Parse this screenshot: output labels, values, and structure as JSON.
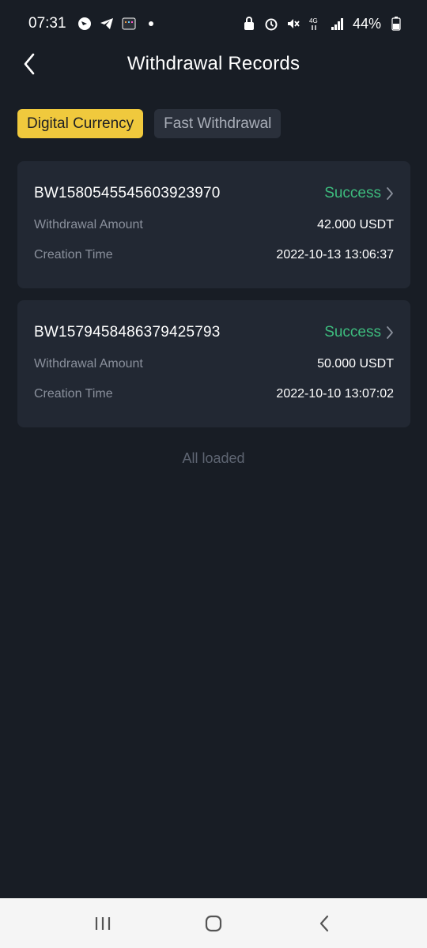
{
  "status_bar": {
    "time": "07:31",
    "battery": "44%",
    "network": "4G"
  },
  "header": {
    "title": "Withdrawal Records",
    "back_icon": "chevron-left-icon"
  },
  "tabs": [
    {
      "label": "Digital Currency",
      "active": true
    },
    {
      "label": "Fast Withdrawal",
      "active": false
    }
  ],
  "records": [
    {
      "id": "BW1580545545603923970",
      "status": "Success",
      "amount_label": "Withdrawal Amount",
      "amount": "42.000 USDT",
      "time_label": "Creation Time",
      "time": "2022-10-13 13:06:37"
    },
    {
      "id": "BW1579458486379425793",
      "status": "Success",
      "amount_label": "Withdrawal Amount",
      "amount": "50.000 USDT",
      "time_label": "Creation Time",
      "time": "2022-10-10 13:07:02"
    }
  ],
  "footer_text": "All loaded",
  "colors": {
    "background": "#181d25",
    "card": "#222833",
    "accent": "#f0c93d",
    "success": "#3dbb7d"
  }
}
